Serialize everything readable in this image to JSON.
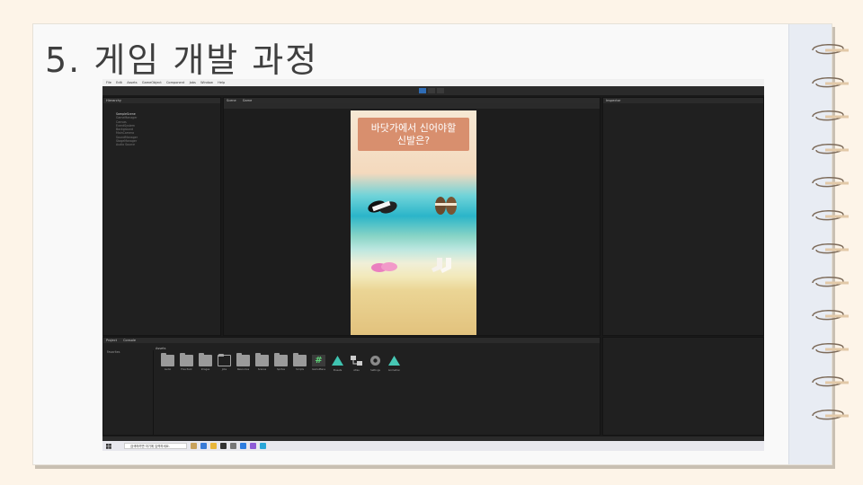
{
  "slide": {
    "title": "5. 게임 개발 과정"
  },
  "unity": {
    "menu": [
      "File",
      "Edit",
      "Assets",
      "GameObject",
      "Component",
      "Jobs",
      "Window",
      "Help"
    ],
    "hierarchy_tab": "Hierarchy",
    "scene_tab": "Scene",
    "game_tab": "Game",
    "inspector_tab": "Inspector",
    "project_tab": "Project",
    "console_tab": "Console",
    "hierarchy_root": "SampleScene",
    "hierarchy_items": [
      "GameManager",
      "Canvas",
      "EventSystem",
      "Background",
      "MainCamera",
      "SoundManager",
      "StageManager",
      "Audio Source"
    ],
    "favorites_label": "Favorites",
    "assets_label": "Assets",
    "game_question_line1": "바닷가에서 신어야할",
    "game_question_line2": "신발은?",
    "asset_items": [
      "Audio",
      "Free Pack",
      "Images",
      "Jobs",
      "Resources",
      "Scenes",
      "Sprites",
      "Scripts",
      "GameManager",
      "Presets",
      "Atlas",
      "Settings",
      "Animation"
    ],
    "taskbar_search": "검색하려면 여기에 입력하세요."
  },
  "colors": {
    "question_box": "#d88f6e",
    "unity_dark": "#202020",
    "slide_bg": "#fdf4e8"
  }
}
